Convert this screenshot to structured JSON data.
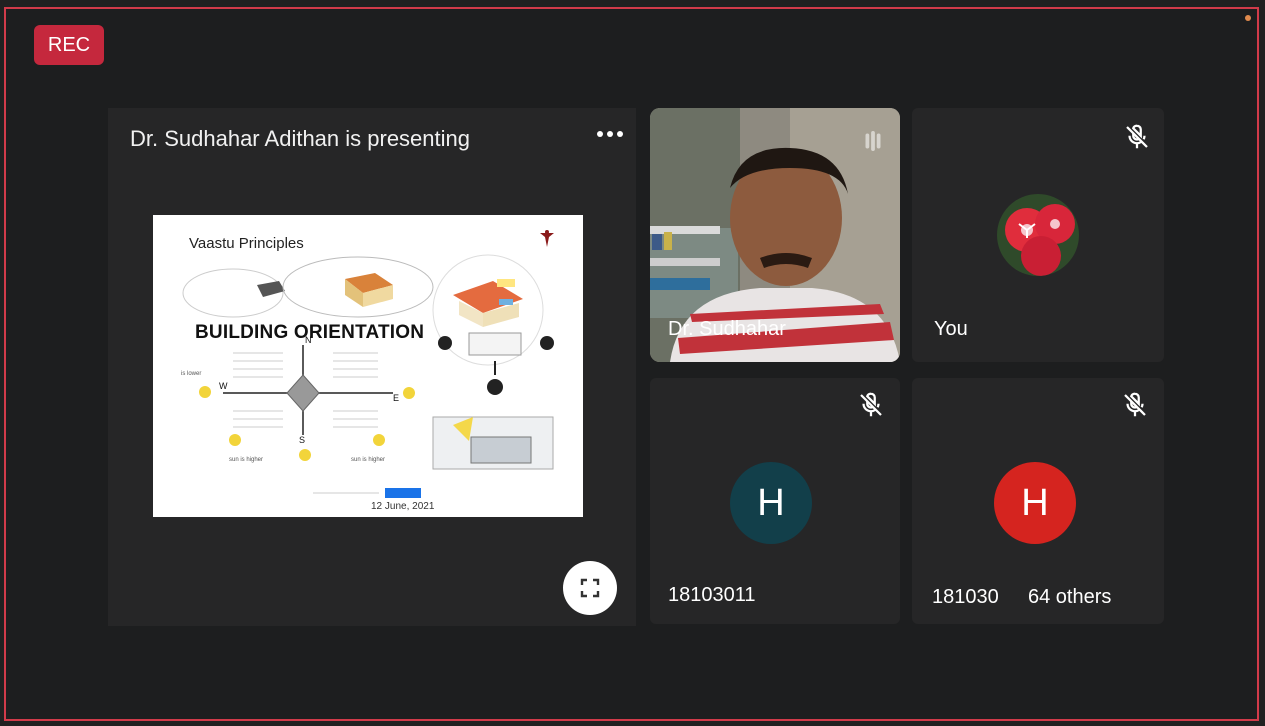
{
  "rec_label": "REC",
  "presenter": {
    "title": "Dr. Sudhahar Adithan is presenting",
    "more_icon": "more-horiz-icon"
  },
  "slide": {
    "title": "Vaastu Principles",
    "heading": "BUILDING ORIENTATION",
    "compass": {
      "n": "N",
      "s": "S",
      "e": "E",
      "w": "W"
    },
    "sun_note_left": "sun is higher",
    "sun_note_right": "sun is higher",
    "left_note": "is lower",
    "date": "12 June, 2021"
  },
  "participants": {
    "video_tile": {
      "name": "Dr. Sudhahar"
    },
    "you_tile": {
      "name": "You"
    },
    "tile3": {
      "name": "18103011",
      "initial": "H",
      "color": "#123f4a"
    },
    "tile4": {
      "name": "181030",
      "others": "64 others",
      "initial": "H",
      "color": "#d5241f"
    }
  },
  "colors": {
    "rec": "#c5283d",
    "frame": "#d23b4a",
    "tile_bg": "#262627"
  },
  "icons": {
    "mic_off": "mic-off-icon",
    "fullscreen": "fullscreen-icon"
  }
}
